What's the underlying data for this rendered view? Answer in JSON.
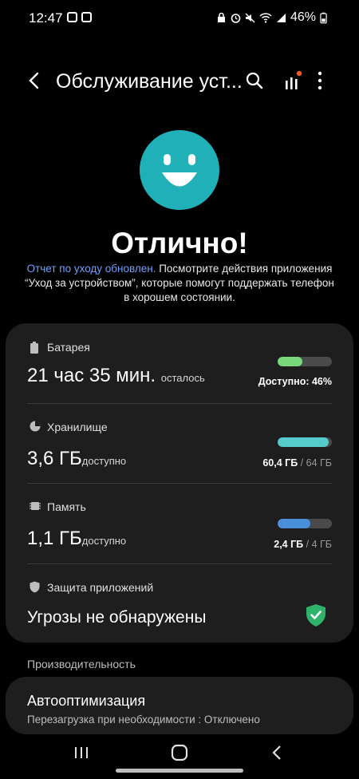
{
  "status_bar": {
    "time": "12:47",
    "battery": "46%"
  },
  "app_bar": {
    "title": "Обслуживание уст..."
  },
  "hero": {
    "headline": "Отлично!",
    "link_text": "Отчет по уходу обновлен.",
    "description": "Посмотрите действия приложения “Уход за устройством”, которые помогут поддержать телефон в хорошем состоянии."
  },
  "battery": {
    "label": "Батарея",
    "value": "21 час 35 мин.",
    "suffix": "осталось",
    "meter_label": "Доступно: 46%",
    "fill_percent": 46,
    "color": "#79d879"
  },
  "storage": {
    "label": "Хранилище",
    "value": "3,6 ГБ",
    "suffix": "доступно",
    "used": "60,4 ГБ",
    "total": "/ 64 ГБ",
    "fill_percent": 94,
    "color": "#55cbcb"
  },
  "memory": {
    "label": "Память",
    "value": "1,1 ГБ",
    "suffix": "доступно",
    "used": "2,4 ГБ",
    "total": "/ 4 ГБ",
    "fill_percent": 60,
    "color": "#4a8fdc"
  },
  "protection": {
    "label": "Защита приложений",
    "value": "Угрозы не обнаружены",
    "color": "#2fb36b"
  },
  "performance": {
    "section_label": "Производительность",
    "title": "Автооптимизация",
    "subtitle": "Перезагрузка при необходимости : Отключено"
  }
}
